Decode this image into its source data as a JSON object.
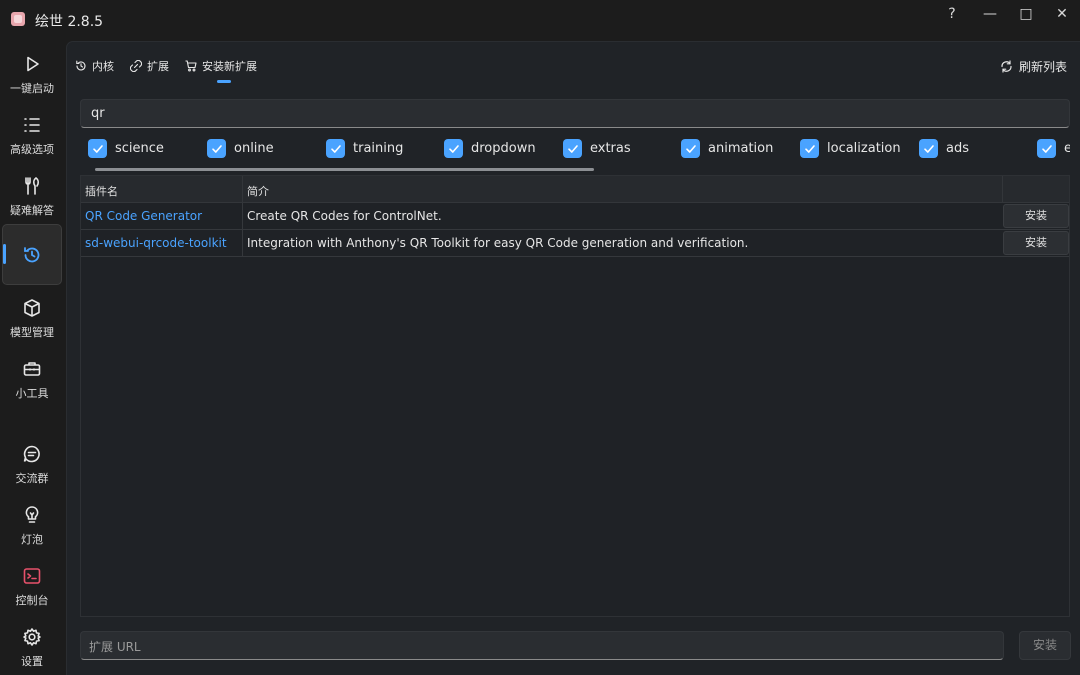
{
  "app": {
    "title": "绘世 2.8.5"
  },
  "window_controls": {
    "help": "?",
    "minimize": "—",
    "maximize": "□",
    "close": "✕"
  },
  "sidebar": {
    "items": [
      {
        "label": "一键启动",
        "icon": "play-icon"
      },
      {
        "label": "高级选项",
        "icon": "list-icon"
      },
      {
        "label": "疑难解答",
        "icon": "tools-icon"
      },
      {
        "label": "",
        "icon": "history-icon",
        "active": true
      },
      {
        "label": "模型管理",
        "icon": "cube-icon"
      },
      {
        "label": "小工具",
        "icon": "toolbox-icon"
      },
      {
        "label": "交流群",
        "icon": "chat-icon"
      },
      {
        "label": "灯泡",
        "icon": "lightbulb-icon"
      },
      {
        "label": "控制台",
        "icon": "terminal-icon"
      },
      {
        "label": "设置",
        "icon": "gear-icon"
      }
    ]
  },
  "tabs": [
    {
      "label": "内核",
      "icon": "history-icon"
    },
    {
      "label": "扩展",
      "icon": "plugin-icon"
    },
    {
      "label": "安装新扩展",
      "icon": "cart-icon",
      "active": true
    }
  ],
  "refresh_label": "刷新列表",
  "search": {
    "value": "qr"
  },
  "tags": [
    "science",
    "online",
    "training",
    "dropdown",
    "extras",
    "animation",
    "localization",
    "ads",
    "e"
  ],
  "table": {
    "headers": [
      "插件名",
      "简介",
      ""
    ],
    "rows": [
      {
        "name": "QR Code Generator",
        "desc": "Create QR Codes for ControlNet.",
        "action": "安装"
      },
      {
        "name": "sd-webui-qrcode-toolkit",
        "desc": "Integration with Anthony's QR Toolkit for easy QR Code generation and verification.",
        "action": "安装"
      }
    ]
  },
  "footer": {
    "url_placeholder": "扩展 URL",
    "install_label": "安装"
  },
  "colors": {
    "accent": "#4aa3ff",
    "background": "#1c1c1c",
    "panel": "#202327"
  }
}
